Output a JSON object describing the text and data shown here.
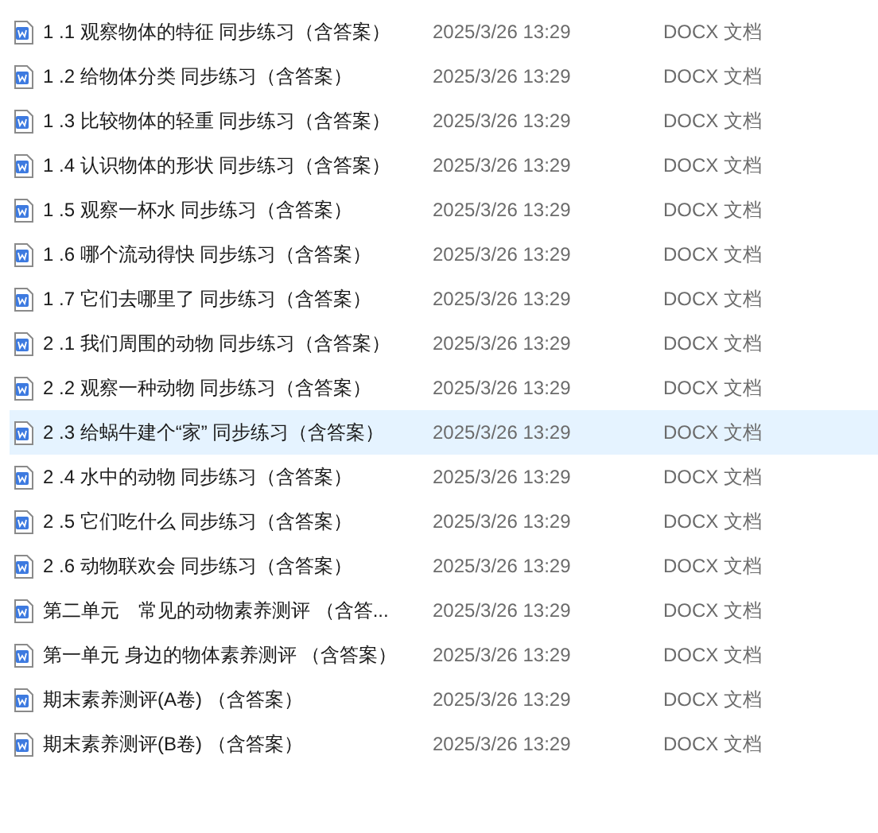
{
  "files": [
    {
      "name": "1 .1 观察物体的特征 同步练习（含答案）",
      "modified": "2025/3/26 13:29",
      "type": "DOCX 文档",
      "selected": false
    },
    {
      "name": "1 .2 给物体分类 同步练习（含答案）",
      "modified": "2025/3/26 13:29",
      "type": "DOCX 文档",
      "selected": false
    },
    {
      "name": "1 .3 比较物体的轻重 同步练习（含答案）",
      "modified": "2025/3/26 13:29",
      "type": "DOCX 文档",
      "selected": false
    },
    {
      "name": "1 .4 认识物体的形状 同步练习（含答案）",
      "modified": "2025/3/26 13:29",
      "type": "DOCX 文档",
      "selected": false
    },
    {
      "name": "1 .5 观察一杯水 同步练习（含答案）",
      "modified": "2025/3/26 13:29",
      "type": "DOCX 文档",
      "selected": false
    },
    {
      "name": "1 .6 哪个流动得快 同步练习（含答案）",
      "modified": "2025/3/26 13:29",
      "type": "DOCX 文档",
      "selected": false
    },
    {
      "name": "1 .7 它们去哪里了 同步练习（含答案）",
      "modified": "2025/3/26 13:29",
      "type": "DOCX 文档",
      "selected": false
    },
    {
      "name": "2 .1 我们周围的动物 同步练习（含答案）",
      "modified": "2025/3/26 13:29",
      "type": "DOCX 文档",
      "selected": false
    },
    {
      "name": "2 .2 观察一种动物 同步练习（含答案）",
      "modified": "2025/3/26 13:29",
      "type": "DOCX 文档",
      "selected": false
    },
    {
      "name": "2 .3 给蜗牛建个“家” 同步练习（含答案）",
      "modified": "2025/3/26 13:29",
      "type": "DOCX 文档",
      "selected": true
    },
    {
      "name": "2 .4 水中的动物 同步练习（含答案）",
      "modified": "2025/3/26 13:29",
      "type": "DOCX 文档",
      "selected": false
    },
    {
      "name": "2 .5 它们吃什么 同步练习（含答案）",
      "modified": "2025/3/26 13:29",
      "type": "DOCX 文档",
      "selected": false
    },
    {
      "name": "2 .6 动物联欢会 同步练习（含答案）",
      "modified": "2025/3/26 13:29",
      "type": "DOCX 文档",
      "selected": false
    },
    {
      "name": "第二单元　常见的动物素养测评 （含答...",
      "modified": "2025/3/26 13:29",
      "type": "DOCX 文档",
      "selected": false
    },
    {
      "name": "第一单元 身边的物体素养测评 （含答案）",
      "modified": "2025/3/26 13:29",
      "type": "DOCX 文档",
      "selected": false
    },
    {
      "name": "期末素养测评(A卷) （含答案）",
      "modified": "2025/3/26 13:29",
      "type": "DOCX 文档",
      "selected": false
    },
    {
      "name": "期末素养测评(B卷) （含答案）",
      "modified": "2025/3/26 13:29",
      "type": "DOCX 文档",
      "selected": false
    }
  ]
}
